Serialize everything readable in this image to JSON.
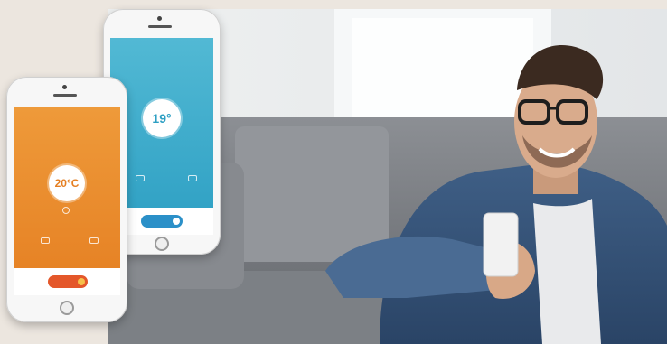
{
  "phone_orange": {
    "header": "",
    "temperature": "20°C",
    "accent": "#ea8a2a",
    "toggle_color": "#e4572a"
  },
  "phone_blue": {
    "temperature": "19°",
    "accent": "#3aaac6",
    "toggle_color": "#2b90c8"
  },
  "icons": [
    "fan-icon",
    "mode-icon",
    "thermometer-icon",
    "home-button"
  ]
}
